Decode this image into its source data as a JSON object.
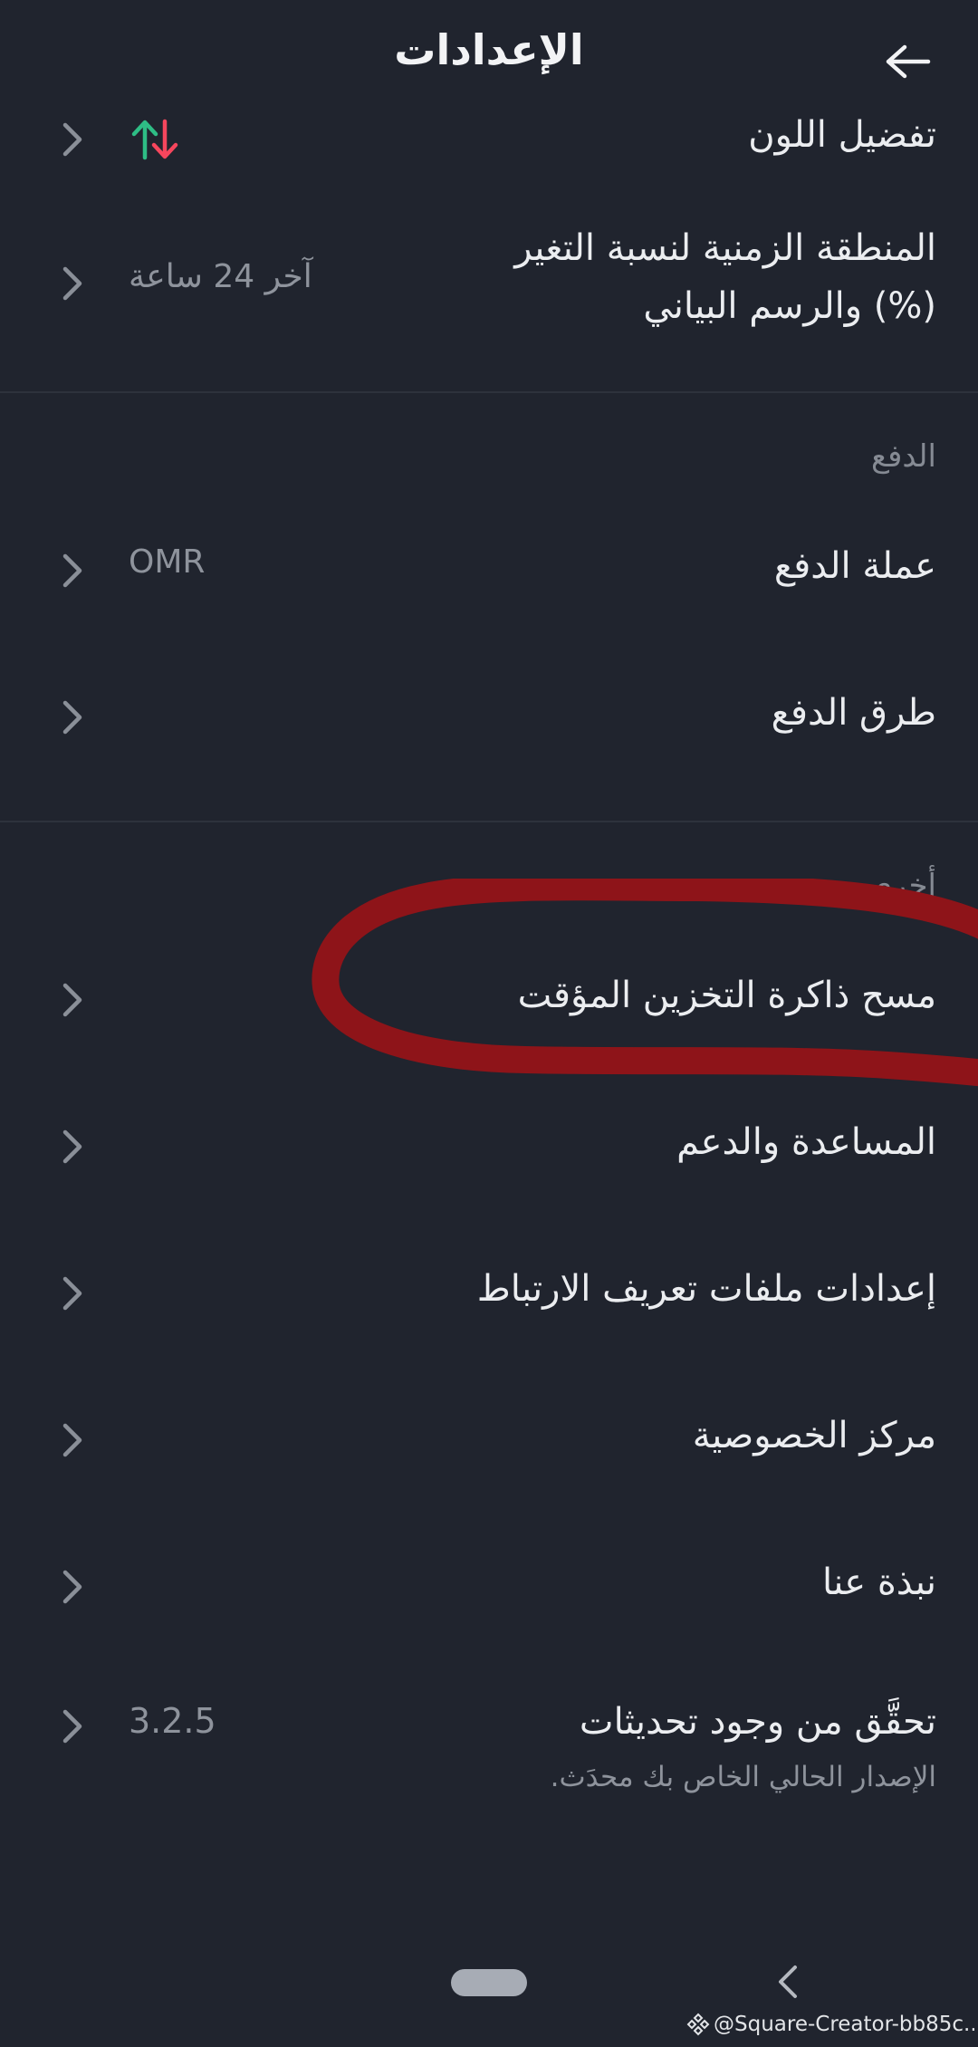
{
  "header": {
    "title": "الإعدادات",
    "back_icon": "arrow-left-icon"
  },
  "rows": {
    "color_preference": {
      "label": "تفضيل اللون",
      "icon": "up-down-arrows-icon",
      "up_color": "#2ebd85",
      "down_color": "#f6465d"
    },
    "timezone": {
      "label_line1": "المنطقة الزمنية لنسبة التغير",
      "label_line2": "(%) والرسم البياني",
      "value": "آخر 24 ساعة"
    },
    "payment_currency": {
      "label": "عملة الدفع",
      "value": "OMR"
    },
    "payment_methods": {
      "label": "طرق الدفع"
    },
    "clear_cache": {
      "label": "مسح ذاكرة التخزين المؤقت"
    },
    "help_support": {
      "label": "المساعدة والدعم"
    },
    "deeplink_settings": {
      "label": "إعدادات ملفات تعريف الارتباط"
    },
    "privacy_center": {
      "label": "مركز الخصوصية"
    },
    "about_us": {
      "label": "نبذة عنا"
    },
    "check_updates": {
      "label": "تحقَّق من وجود تحديثات",
      "subtext": "الإصدار الحالي الخاص بك محدَث.",
      "value": "3.2.5"
    }
  },
  "sections": {
    "payment": "الدفع",
    "other": "أخرى"
  },
  "annotation": {
    "color": "#8e1419"
  },
  "watermark": {
    "text": "@Square-Creator-bb85c..."
  },
  "colors": {
    "background": "#20242e",
    "text": "#ebedf0",
    "muted": "#8e939c",
    "chevron": "#8a8f98"
  }
}
